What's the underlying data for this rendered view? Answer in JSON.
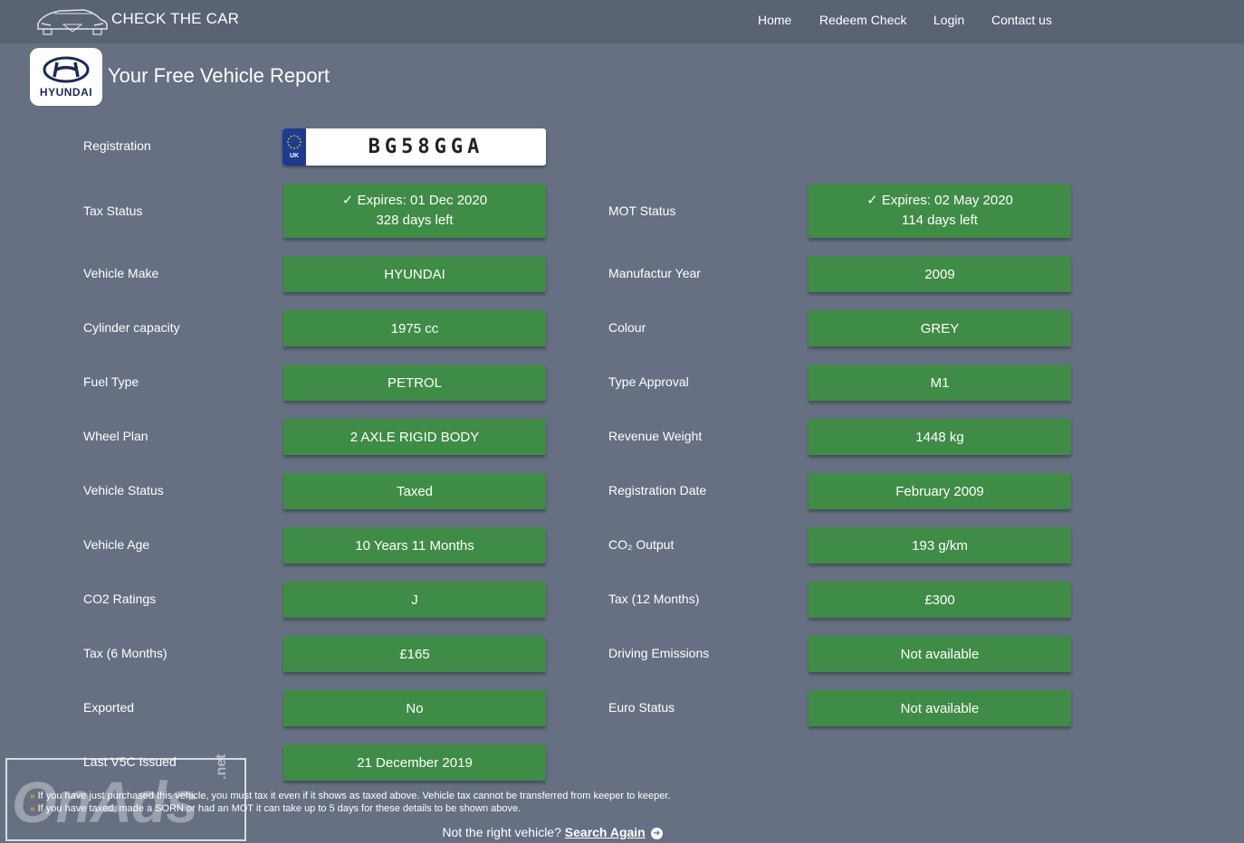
{
  "header": {
    "brand": "CHECK THE CAR",
    "nav": [
      "Home",
      "Redeem Check",
      "Login",
      "Contact us"
    ]
  },
  "report": {
    "logo_text": "HYUNDAI",
    "title": "Your Free Vehicle Report",
    "registration_label": "Registration",
    "plate_country": "UK",
    "registration": "BG58GGA"
  },
  "tax_status": {
    "label": "Tax Status",
    "line1": "✓ Expires: 01 Dec 2020",
    "line2": "328 days left"
  },
  "mot_status": {
    "label": "MOT Status",
    "line1": "✓ Expires: 02 May 2020",
    "line2": "114 days left"
  },
  "left_rows": [
    {
      "label": "Vehicle Make",
      "value": "HYUNDAI"
    },
    {
      "label": "Cylinder capacity",
      "value": "1975 cc"
    },
    {
      "label": "Fuel Type",
      "value": "PETROL"
    },
    {
      "label": "Wheel Plan",
      "value": "2 AXLE RIGID BODY"
    },
    {
      "label": "Vehicle Status",
      "value": "Taxed"
    },
    {
      "label": "Vehicle Age",
      "value": "10 Years 11 Months"
    },
    {
      "label": "CO2 Ratings",
      "value": "J"
    },
    {
      "label": "Tax (6 Months)",
      "value": "£165"
    },
    {
      "label": "Exported",
      "value": "No"
    },
    {
      "label": "Last V5C Issued",
      "value": "21 December 2019"
    }
  ],
  "right_rows": [
    {
      "label": "Manufactur Year",
      "value": "2009"
    },
    {
      "label": "Colour",
      "value": "GREY"
    },
    {
      "label": "Type Approval",
      "value": "M1"
    },
    {
      "label": "Revenue Weight",
      "value": "1448 kg"
    },
    {
      "label": "Registration Date",
      "value": "February 2009"
    },
    {
      "label": "CO₂ Output",
      "value": "193 g/km"
    },
    {
      "label": "Tax (12 Months)",
      "value": "£300"
    },
    {
      "label": "Driving Emissions",
      "value": "Not available"
    },
    {
      "label": "Euro Status",
      "value": "Not available"
    }
  ],
  "notes": [
    "If you have just purchased this vehicle, you must tax it even if it shows as taxed above. Vehicle tax cannot be transferred from keeper to keeper.",
    "If you have taxed, made a SORN or had an MOT it can take up to 5 days for these details to be shown above."
  ],
  "footer": {
    "question": "Not the right vehicle?",
    "link": "Search Again"
  },
  "watermark": {
    "text": "OnAds",
    "sub": ".net"
  },
  "colors": {
    "background": "#667082",
    "header": "#5a6373",
    "value_box": "#3f8c46",
    "plate_band": "#1f3b8f",
    "note_chevron": "#f0a020"
  }
}
